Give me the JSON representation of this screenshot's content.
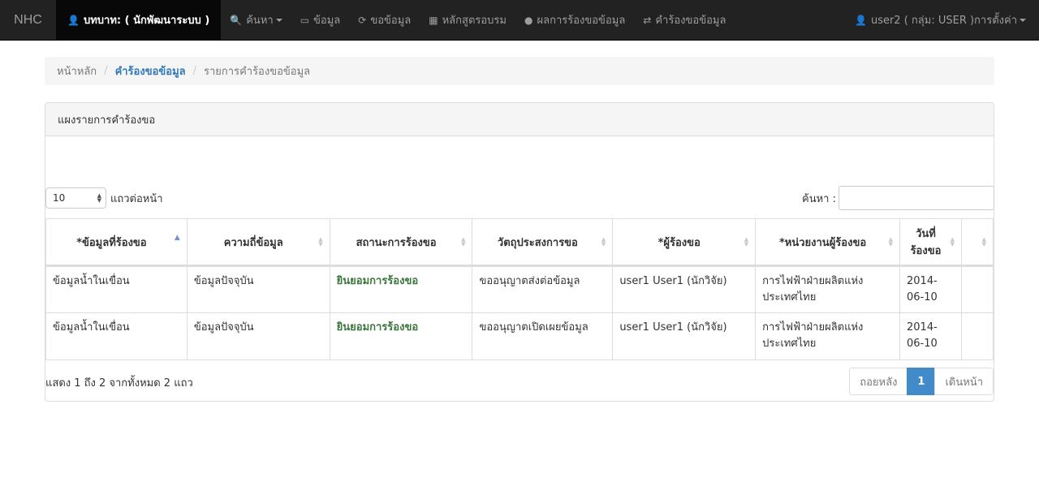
{
  "navbar": {
    "brand": "NHC",
    "role_label": "บทบาท: ( นักพัฒนาระบบ )",
    "items": [
      {
        "label": "ค้นหา",
        "icon": "search-icon"
      },
      {
        "label": "ข้อมูล",
        "icon": "hdd-icon"
      },
      {
        "label": "ขอข้อมูล",
        "icon": "refresh-icon"
      },
      {
        "label": "หลักสูตรอบรม",
        "icon": "calendar-icon"
      },
      {
        "label": "ผลการร้องขอข้อมูล",
        "icon": "comment-icon"
      },
      {
        "label": "คำร้องขอข้อมูล",
        "icon": "transfer-icon"
      }
    ],
    "user_label": "user2 ( กลุ่ม: USER )การตั้งค่า"
  },
  "breadcrumb": {
    "home": "หน้าหลัก",
    "section": "คำร้องขอข้อมูล",
    "current": "รายการคำร้องขอข้อมูล"
  },
  "panel": {
    "title": "แผงรายการคำร้องขอ",
    "page_length": "10",
    "page_length_label": "แถวต่อหน้า",
    "search_label": "ค้นหา :",
    "search_value": "",
    "columns": [
      "*ข้อมูลที่ร้องขอ",
      "ความถี่ข้อมูล",
      "สถานะการร้องขอ",
      "วัตถุประสงการขอ",
      "*ผู้ร้องขอ",
      "*หน่วยงานผู้ร้องขอ",
      "วันที่ร้องขอ",
      ""
    ],
    "rows": [
      [
        "ข้อมูลน้ำในเขื่อน",
        "ข้อมูลปัจจุบัน",
        "ยินยอมการร้องขอ",
        "ขออนุญาตส่งต่อข้อมูล",
        "user1 User1 (นักวิจัย)",
        "การไฟฟ้าฝ่ายผลิตแห่งประเทศไทย",
        "2014-06-10",
        ""
      ],
      [
        "ข้อมูลน้ำในเขื่อน",
        "ข้อมูลปัจจุบัน",
        "ยินยอมการร้องขอ",
        "ขออนุญาตเปิดเผยข้อมูล",
        "user1 User1 (นักวิจัย)",
        "การไฟฟ้าฝ่ายผลิตแห่งประเทศไทย",
        "2014-06-10",
        ""
      ]
    ],
    "info": "แสดง 1 ถึง 2 จากทั้งหมด 2 แถว",
    "pagination": {
      "prev": "ถอยหลัง",
      "page": "1",
      "next": "เดินหน้า"
    }
  },
  "colors": {
    "navbar_bg": "#222222",
    "link": "#337ab7",
    "status_ok": "#3c763d",
    "page_active": "#428bca"
  }
}
